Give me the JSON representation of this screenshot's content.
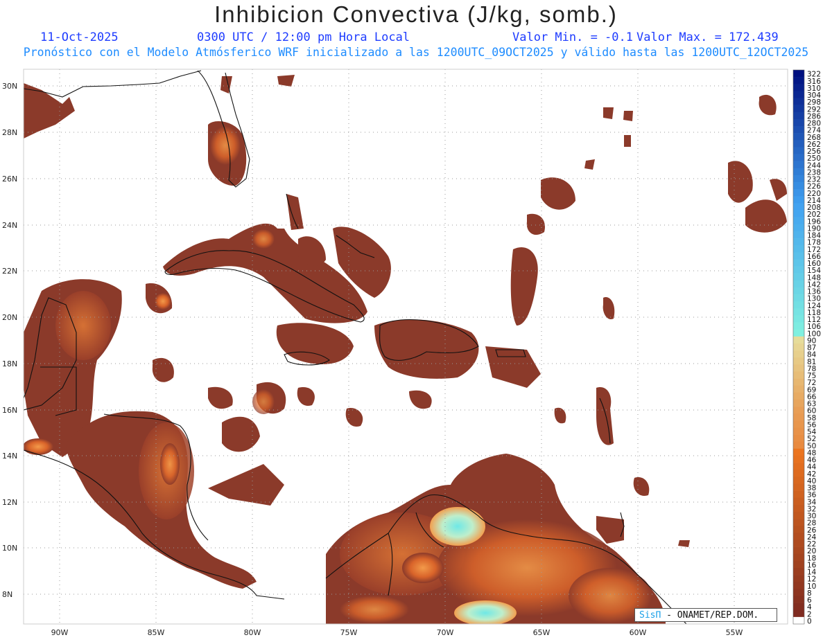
{
  "header": {
    "title": "Inhibicion Convectiva (J/kg, somb.)",
    "date": "11-Oct-2025",
    "time": "0300 UTC / 12:00 pm Hora Local",
    "min": "Valor Min. = -0.1",
    "max": "Valor Max. = 172.439",
    "subtitle": "Pronóstico con el Modelo Atmósferico WRF inicializado a las 1200UTC_09OCT2025 y válido hasta las  1200UTC_12OCT2025"
  },
  "axes": {
    "lat_labels": [
      "30N",
      "28N",
      "26N",
      "24N",
      "22N",
      "20N",
      "18N",
      "16N",
      "14N",
      "12N",
      "10N",
      "8N"
    ],
    "lon_labels": [
      "90W",
      "85W",
      "80W",
      "75W",
      "70W",
      "65W",
      "60W",
      "55W"
    ]
  },
  "colorbar": {
    "labels": [
      "322",
      "316",
      "310",
      "304",
      "298",
      "292",
      "286",
      "280",
      "274",
      "268",
      "262",
      "256",
      "250",
      "244",
      "238",
      "232",
      "226",
      "220",
      "214",
      "208",
      "202",
      "196",
      "190",
      "184",
      "178",
      "172",
      "166",
      "160",
      "154",
      "148",
      "142",
      "136",
      "130",
      "124",
      "118",
      "112",
      "106",
      "100",
      "90",
      "87",
      "84",
      "81",
      "78",
      "75",
      "72",
      "69",
      "66",
      "63",
      "60",
      "58",
      "56",
      "54",
      "52",
      "50",
      "48",
      "46",
      "44",
      "42",
      "40",
      "38",
      "36",
      "34",
      "32",
      "30",
      "28",
      "26",
      "24",
      "22",
      "20",
      "18",
      "16",
      "14",
      "12",
      "10",
      "8",
      "6",
      "4",
      "2",
      "0"
    ]
  },
  "credit": {
    "brand": "SisΠ",
    "text": " - ONAMET/REP.DOM."
  },
  "colors": {
    "base": "#8b3a2a",
    "warm": "#c2501e",
    "hot": "#f08a3a",
    "light": "#f7d28a",
    "cyan": "#7ff0e6",
    "coast": "#111111"
  }
}
